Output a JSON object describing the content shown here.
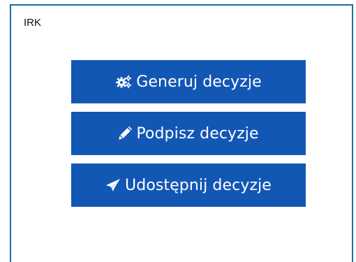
{
  "panel": {
    "title": "IRK"
  },
  "actions": [
    {
      "label": "Generuj decyzje",
      "icon": "gears-icon"
    },
    {
      "label": "Podpisz decyzje",
      "icon": "pencil-icon"
    },
    {
      "label": "Udostępnij decyzje",
      "icon": "paper-plane-icon"
    }
  ],
  "colors": {
    "border": "#1a6fa0",
    "button_bg": "#1357b5",
    "button_text": "#ffffff"
  }
}
